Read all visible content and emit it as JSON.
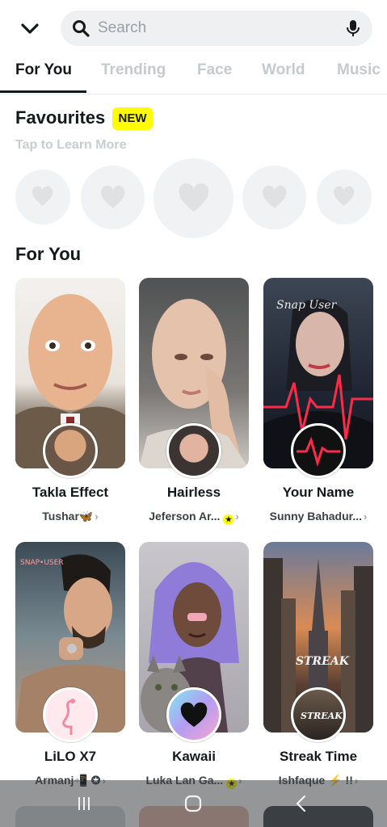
{
  "search": {
    "placeholder": "Search"
  },
  "tabs": [
    {
      "label": "For You",
      "active": true
    },
    {
      "label": "Trending",
      "active": false
    },
    {
      "label": "Face",
      "active": false
    },
    {
      "label": "World",
      "active": false
    },
    {
      "label": "Music",
      "active": false
    }
  ],
  "favourites": {
    "title": "Favourites",
    "badge": "NEW",
    "subtitle": "Tap to Learn More",
    "slot_icon": "heart-icon"
  },
  "for_you": {
    "title": "For You",
    "cards": [
      {
        "name": "Takla Effect",
        "author": "Tushar🦋",
        "verified": false
      },
      {
        "name": "Hairless",
        "author": "Jeferson Ar...",
        "verified": true
      },
      {
        "name": "Your Name",
        "author": "Sunny Bahadur...",
        "verified": false
      },
      {
        "name": "LiLO X7",
        "author": "Armanj📲 ✪",
        "verified": false
      },
      {
        "name": "Kawaii",
        "author": "Luka Lan Ga...",
        "verified": true
      },
      {
        "name": "Streak Time",
        "author": "Ishfaque ⚡ !!",
        "verified": false
      }
    ]
  },
  "colors": {
    "accent_yellow": "#fffc00",
    "text_dark": "#16191c",
    "inactive_tab": "#c7cacd",
    "search_bg": "#eef0f2"
  },
  "navbar": {
    "icons": [
      "recents-icon",
      "home-icon",
      "back-icon"
    ]
  }
}
